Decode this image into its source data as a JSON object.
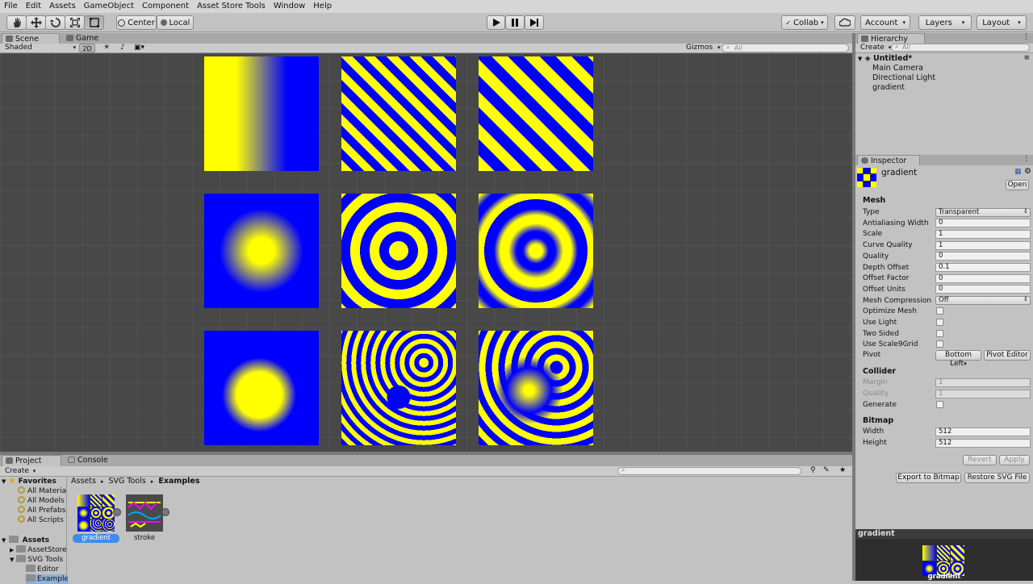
{
  "menu": [
    "File",
    "Edit",
    "Assets",
    "GameObject",
    "Component",
    "Asset Store Tools",
    "Window",
    "Help"
  ],
  "toolbar": {
    "pivot_label": "Center",
    "space_label": "Local",
    "collab_label": "Collab",
    "account_label": "Account",
    "layers_label": "Layers",
    "layout_label": "Layout"
  },
  "scene": {
    "tabs": [
      "Scene",
      "Game"
    ],
    "shading_mode": "Shaded",
    "mode_2d": "2D",
    "gizmos_label": "Gizmos",
    "search_placeholder": "All"
  },
  "hierarchy": {
    "title": "Hierarchy",
    "create_label": "Create",
    "search_placeholder": "All",
    "scene_name": "Untitled*",
    "items": [
      "Main Camera",
      "Directional Light",
      "gradient"
    ]
  },
  "inspector": {
    "title": "Inspector",
    "object_name": "gradient",
    "open_label": "Open",
    "mesh_section": "Mesh",
    "mesh_fields": [
      {
        "label": "Type",
        "value": "Transparent",
        "kind": "dropdown"
      },
      {
        "label": "Antialiasing Width",
        "value": "0",
        "kind": "field"
      },
      {
        "label": "Scale",
        "value": "1",
        "kind": "field"
      },
      {
        "label": "Curve Quality",
        "value": "1",
        "kind": "field"
      },
      {
        "label": "Quality",
        "value": "0",
        "kind": "field"
      },
      {
        "label": "Depth Offset",
        "value": "0.1",
        "kind": "field"
      },
      {
        "label": "Offset Factor",
        "value": "0",
        "kind": "field"
      },
      {
        "label": "Offset Units",
        "value": "0",
        "kind": "field"
      },
      {
        "label": "Mesh Compression",
        "value": "Off",
        "kind": "dropdown"
      },
      {
        "label": "Optimize Mesh",
        "value": "",
        "kind": "check"
      },
      {
        "label": "Use Light",
        "value": "",
        "kind": "check"
      },
      {
        "label": "Two Sided",
        "value": "",
        "kind": "check"
      },
      {
        "label": "Use Scale9Grid",
        "value": "",
        "kind": "check"
      }
    ],
    "pivot_label": "Pivot",
    "pivot_value": "Bottom Left",
    "pivot_editor_label": "Pivot Editor",
    "collider_section": "Collider",
    "collider_fields": [
      {
        "label": "Margin",
        "value": "1"
      },
      {
        "label": "Quality",
        "value": "1"
      }
    ],
    "generate_label": "Generate",
    "bitmap_section": "Bitmap",
    "bitmap_fields": [
      {
        "label": "Width",
        "value": "512"
      },
      {
        "label": "Height",
        "value": "512"
      }
    ],
    "revert_label": "Revert",
    "apply_label": "Apply",
    "export_label": "Export to Bitmap",
    "restore_label": "Restore SVG File"
  },
  "preview": {
    "title": "gradient",
    "caption": "gradient"
  },
  "project": {
    "tabs": [
      "Project",
      "Console"
    ],
    "create_label": "Create",
    "breadcrumb": [
      "Assets",
      "SVG Tools",
      "Examples"
    ],
    "favorites_label": "Favorites",
    "favorites": [
      "All Materia",
      "All Models",
      "All Prefabs",
      "All Scripts"
    ],
    "assets_label": "Assets",
    "tree": [
      "AssetStore",
      "SVG Tools",
      "Editor",
      "Example"
    ],
    "files": [
      {
        "name": "gradient",
        "selected": true
      },
      {
        "name": "stroke",
        "selected": false
      }
    ]
  },
  "colors": {
    "yellow": "#ffff00",
    "blue": "#0000ff",
    "viewport_bg": "#484848",
    "selection": "#3d8ee6"
  }
}
